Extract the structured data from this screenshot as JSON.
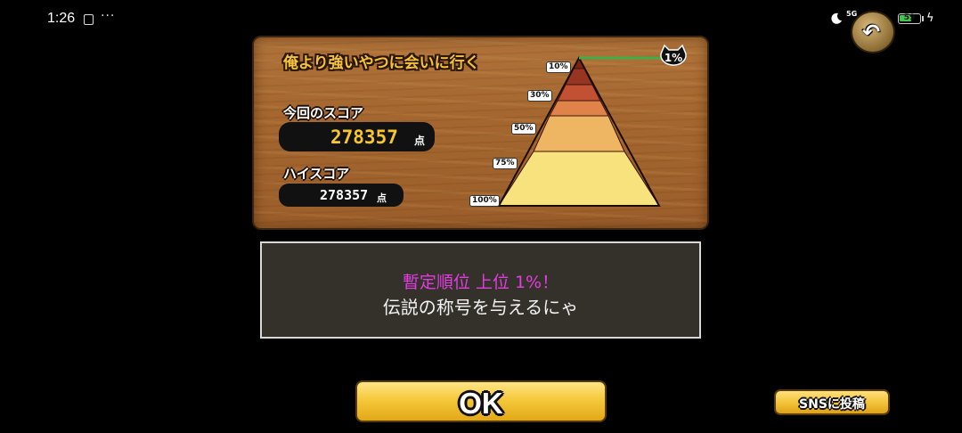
{
  "status_bar": {
    "time": "1:26",
    "more": "···",
    "network": "5G",
    "battery": "59",
    "battery_level_percent": 59,
    "accent_battery": "#43c84b"
  },
  "board": {
    "stage_title": "俺より強いやつに会いに行く",
    "current_score_label": "今回のスコア",
    "current_score_value": "278357",
    "current_score_unit": "点",
    "high_score_label": "ハイスコア",
    "high_score_value": "278357",
    "high_score_unit": "点",
    "pyramid_labels": [
      "10%",
      "30%",
      "50%",
      "75%",
      "100%"
    ],
    "rank_badge": "1%",
    "pyramid_colors": [
      "#7a2418",
      "#963522",
      "#c25032",
      "#e0834a",
      "#eeb563",
      "#f8e27d"
    ],
    "score_color": "#f7c62f"
  },
  "message": {
    "line1": "暫定順位 上位 1%！",
    "line2": "伝説の称号を与えるにゃ",
    "line1_color": "#e23de0"
  },
  "buttons": {
    "ok": "OK",
    "sns": "SNSに投稿"
  }
}
